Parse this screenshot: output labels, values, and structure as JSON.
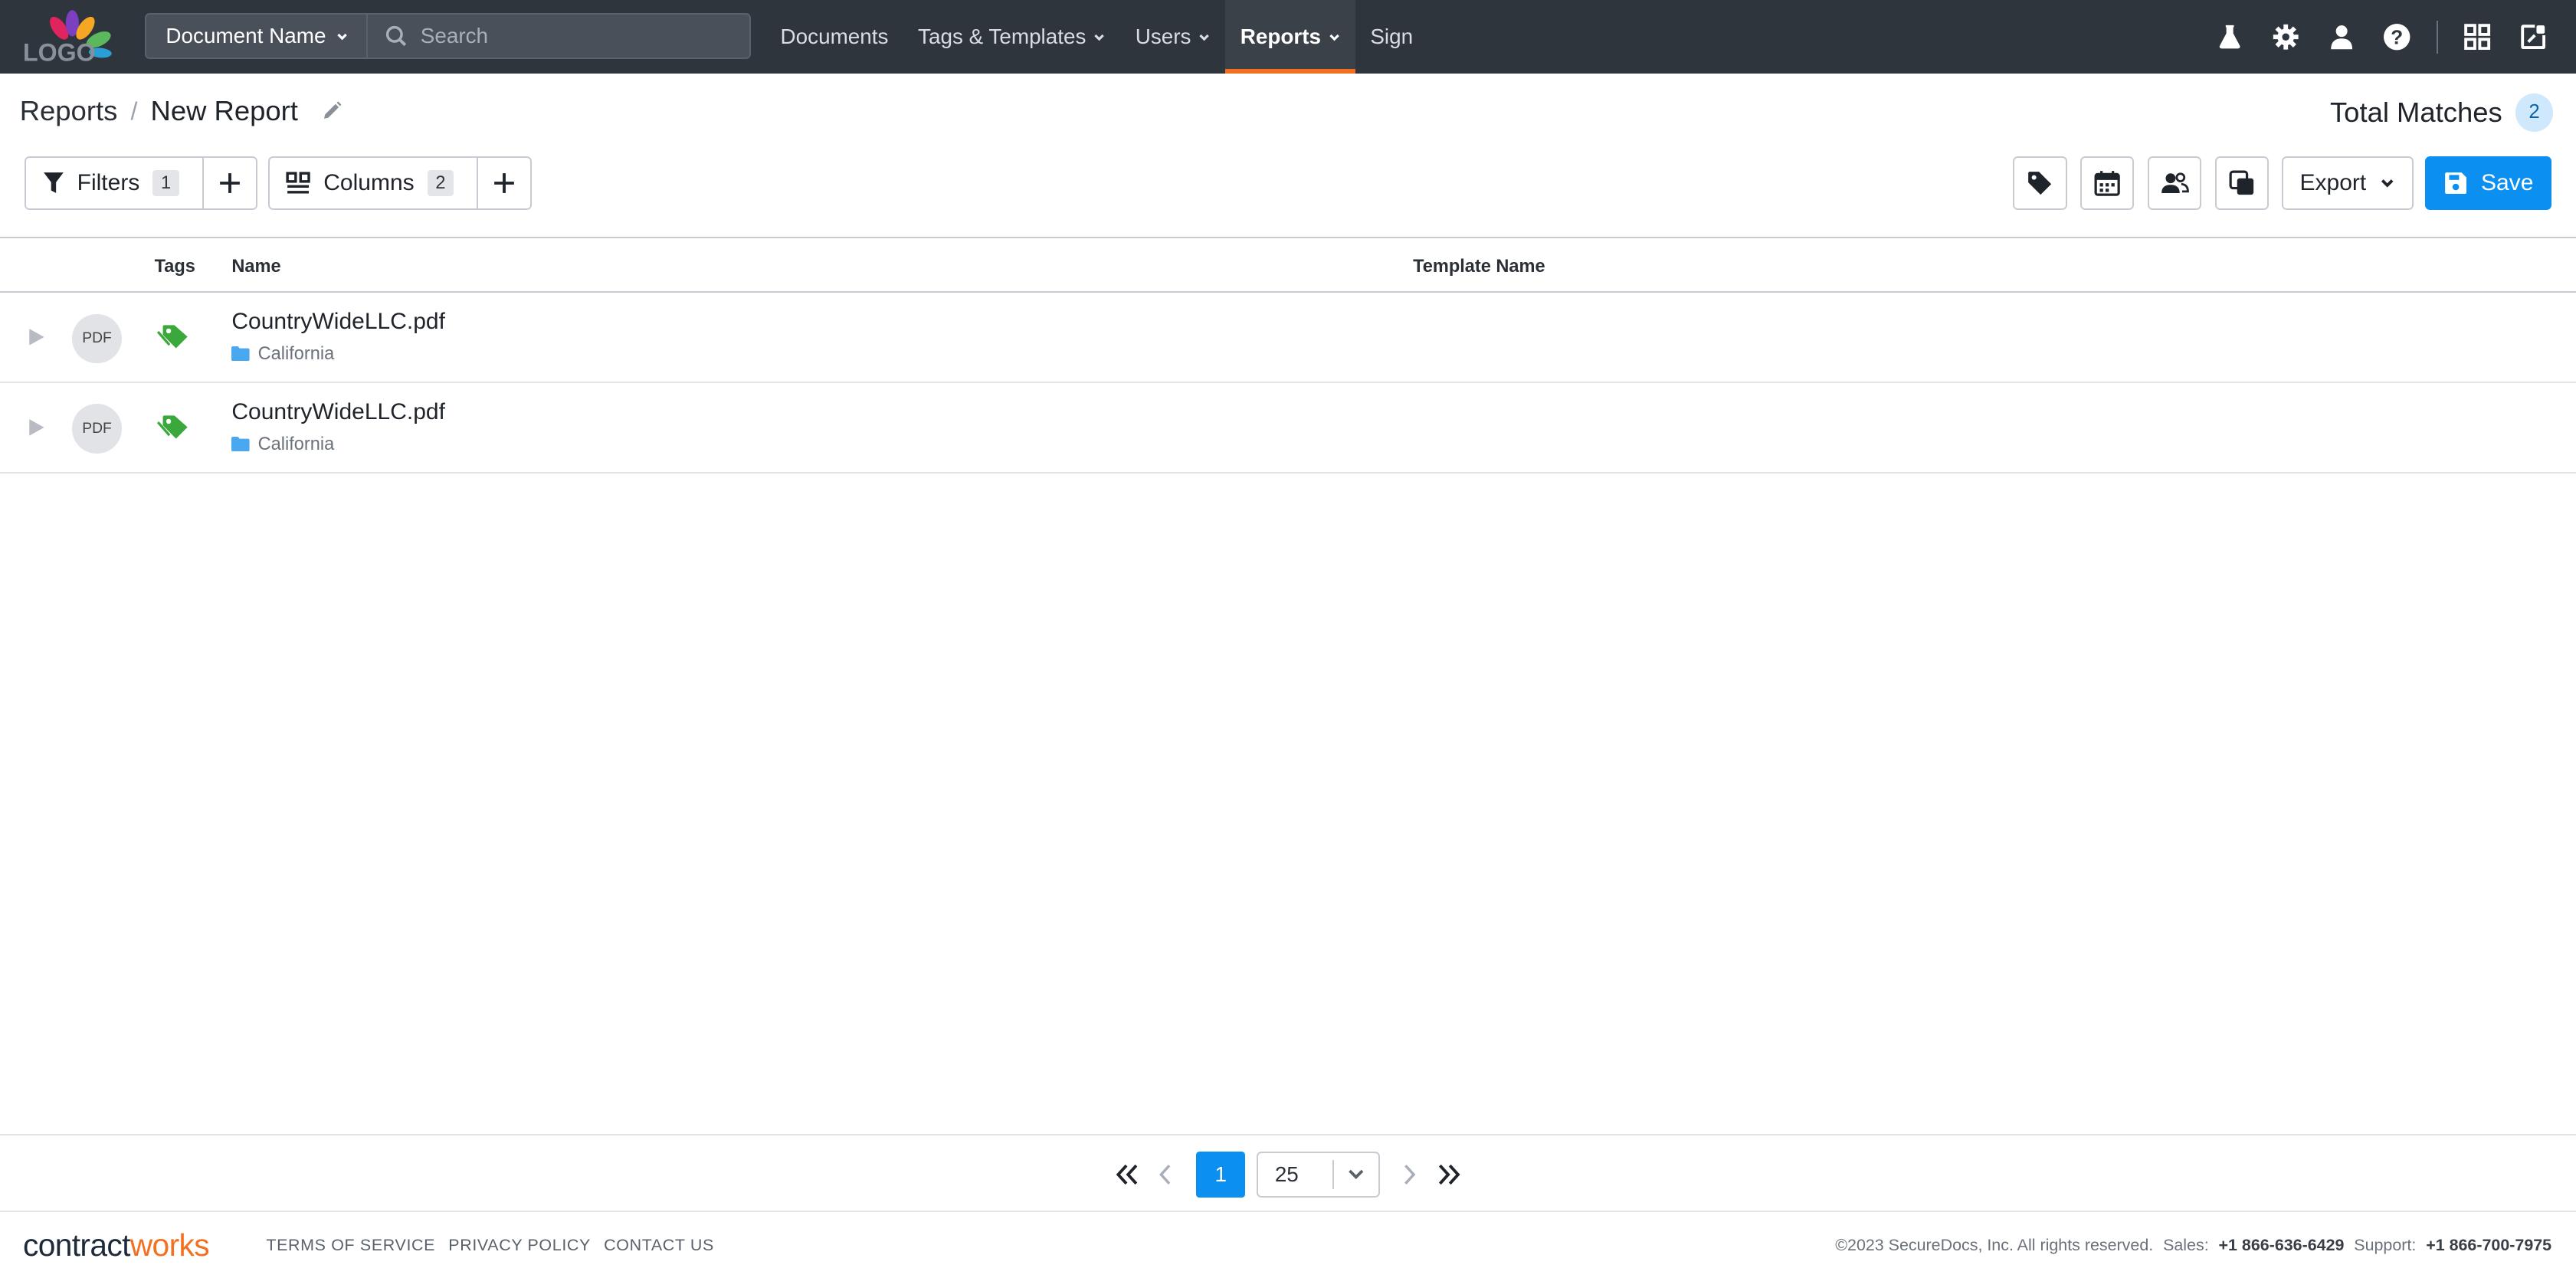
{
  "nav": {
    "logo_text": "LOGO",
    "doc_type_label": "Document Name",
    "search_placeholder": "Search",
    "menu": [
      "Documents",
      "Tags & Templates",
      "Users",
      "Reports",
      "Sign"
    ],
    "active_menu": "Reports"
  },
  "header": {
    "breadcrumb_root": "Reports",
    "breadcrumb_sep": "/",
    "breadcrumb_current": "New Report",
    "total_label": "Total Matches",
    "total_count": "2"
  },
  "toolbar": {
    "filters_label": "Filters",
    "filters_count": "1",
    "columns_label": "Columns",
    "columns_count": "2",
    "export_label": "Export",
    "save_label": "Save"
  },
  "table": {
    "columns": [
      "Tags",
      "Name",
      "Template Name"
    ],
    "rows": [
      {
        "type": "PDF",
        "name": "CountryWideLLC.pdf",
        "folder": "California",
        "template": ""
      },
      {
        "type": "PDF",
        "name": "CountryWideLLC.pdf",
        "folder": "California",
        "template": ""
      }
    ]
  },
  "pagination": {
    "current_page": "1",
    "page_size": "25"
  },
  "footer": {
    "brand_a": "contract",
    "brand_b": "works",
    "links": [
      "TERMS OF SERVICE",
      "PRIVACY POLICY",
      "CONTACT US"
    ],
    "copyright": "©2023 SecureDocs, Inc. All rights reserved.",
    "sales_label": "Sales:",
    "sales_phone": "+1 866-636-6429",
    "support_label": "Support:",
    "support_phone": "+1 866-700-7975"
  },
  "colors": {
    "nav_bg": "#2f353d",
    "accent_orange": "#f37021",
    "primary_blue": "#0b8ff0",
    "tag_green": "#3aa83a",
    "folder_blue": "#4aa8f0"
  }
}
